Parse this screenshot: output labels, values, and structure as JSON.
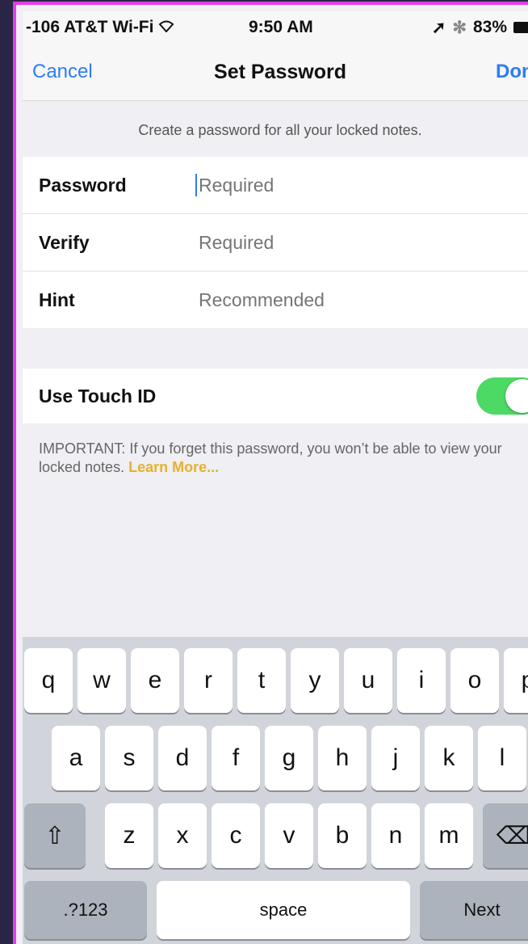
{
  "status_bar": {
    "carrier": "-106 AT&T Wi-Fi",
    "time": "9:50 AM",
    "battery": "83%"
  },
  "nav": {
    "cancel": "Cancel",
    "title": "Set Password",
    "done": "Done"
  },
  "info": "Create a password for all your locked notes.",
  "fields": [
    {
      "label": "Password",
      "placeholder": "Required"
    },
    {
      "label": "Verify",
      "placeholder": "Required"
    },
    {
      "label": "Hint",
      "placeholder": "Recommended"
    }
  ],
  "touch_id": {
    "label": "Use Touch ID",
    "enabled": true,
    "toggle_color": "#4cd964"
  },
  "important": {
    "text": "IMPORTANT: If you forget this password, you won’t be able to view your locked notes.",
    "link": "Learn More..."
  },
  "keyboard": {
    "row1": [
      "q",
      "w",
      "e",
      "r",
      "t",
      "y",
      "u",
      "i",
      "o",
      "p"
    ],
    "row2": [
      "a",
      "s",
      "d",
      "f",
      "g",
      "h",
      "j",
      "k",
      "l"
    ],
    "row3": [
      "z",
      "x",
      "c",
      "v",
      "b",
      "n",
      "m"
    ],
    "shift_icon": "shift-icon",
    "delete_icon": "backspace-icon",
    "numbers": ".?123",
    "space": "space",
    "next": "Next"
  },
  "colors": {
    "accent": "#2d7cf6",
    "link": "#e8b12c",
    "frame": "#e23ee6"
  }
}
